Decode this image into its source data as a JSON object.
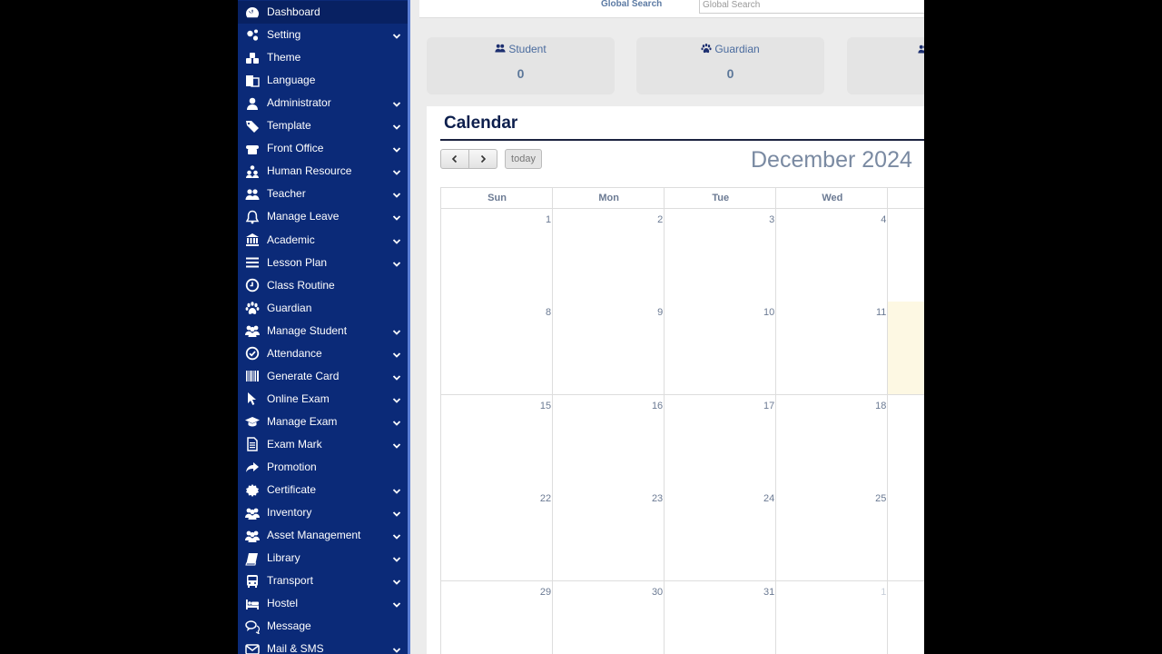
{
  "sidebar": {
    "items": [
      {
        "label": "Dashboard",
        "icon": "dashboard-icon",
        "chevron": false,
        "active": true
      },
      {
        "label": "Setting",
        "icon": "cogs-icon",
        "chevron": true
      },
      {
        "label": "Theme",
        "icon": "cubes-icon",
        "chevron": false
      },
      {
        "label": "Language",
        "icon": "language-icon",
        "chevron": false
      },
      {
        "label": "Administrator",
        "icon": "user-icon",
        "chevron": true
      },
      {
        "label": "Template",
        "icon": "tags-icon",
        "chevron": true
      },
      {
        "label": "Front Office",
        "icon": "phone-icon",
        "chevron": true
      },
      {
        "label": "Human Resource",
        "icon": "sitemap-icon",
        "chevron": true
      },
      {
        "label": "Teacher",
        "icon": "users-icon",
        "chevron": true
      },
      {
        "label": "Manage Leave",
        "icon": "bell-icon",
        "chevron": true
      },
      {
        "label": "Academic",
        "icon": "bank-icon",
        "chevron": true
      },
      {
        "label": "Lesson Plan",
        "icon": "bars-icon",
        "chevron": true
      },
      {
        "label": "Class Routine",
        "icon": "clock-icon",
        "chevron": false
      },
      {
        "label": "Guardian",
        "icon": "paw-icon",
        "chevron": false
      },
      {
        "label": "Manage Student",
        "icon": "group-icon",
        "chevron": true
      },
      {
        "label": "Attendance",
        "icon": "check-circle-icon",
        "chevron": true
      },
      {
        "label": "Generate Card",
        "icon": "barcode-icon",
        "chevron": true
      },
      {
        "label": "Online Exam",
        "icon": "mouse-pointer-icon",
        "chevron": true
      },
      {
        "label": "Manage Exam",
        "icon": "graduation-cap-icon",
        "chevron": true
      },
      {
        "label": "Exam Mark",
        "icon": "file-text-icon",
        "chevron": true
      },
      {
        "label": "Promotion",
        "icon": "share-icon",
        "chevron": false
      },
      {
        "label": "Certificate",
        "icon": "certificate-icon",
        "chevron": true
      },
      {
        "label": "Inventory",
        "icon": "group-icon",
        "chevron": true
      },
      {
        "label": "Asset Management",
        "icon": "group-icon",
        "chevron": true
      },
      {
        "label": "Library",
        "icon": "book-icon",
        "chevron": true
      },
      {
        "label": "Transport",
        "icon": "bus-icon",
        "chevron": true
      },
      {
        "label": "Hostel",
        "icon": "bed-icon",
        "chevron": true
      },
      {
        "label": "Message",
        "icon": "comments-icon",
        "chevron": false
      },
      {
        "label": "Mail & SMS",
        "icon": "envelope-icon",
        "chevron": true
      }
    ]
  },
  "topbar": {
    "search_label": "Global Search",
    "search_placeholder": "Global Search"
  },
  "stats": [
    {
      "label": "Student",
      "value": "0",
      "icon": "users-icon"
    },
    {
      "label": "Guardian",
      "value": "0",
      "icon": "paw-icon"
    }
  ],
  "calendar": {
    "title": "Calendar",
    "today_label": "today",
    "month_title": "December 2024",
    "day_headers": [
      "Sun",
      "Mon",
      "Tue",
      "Wed"
    ],
    "weeks": [
      [
        "1",
        "2",
        "3",
        "4"
      ],
      [
        "8",
        "9",
        "10",
        "11"
      ],
      [
        "15",
        "16",
        "17",
        "18"
      ],
      [
        "22",
        "23",
        "24",
        "25"
      ],
      [
        "29",
        "30",
        "31",
        "1"
      ]
    ],
    "other_month_cells": [
      [
        4,
        3
      ]
    ],
    "highlight_color": "#fdf8e3"
  },
  "colors": {
    "sidebar_bg": "#0b2a78",
    "sidebar_active": "#082162",
    "accent": "#5a7ed6"
  }
}
